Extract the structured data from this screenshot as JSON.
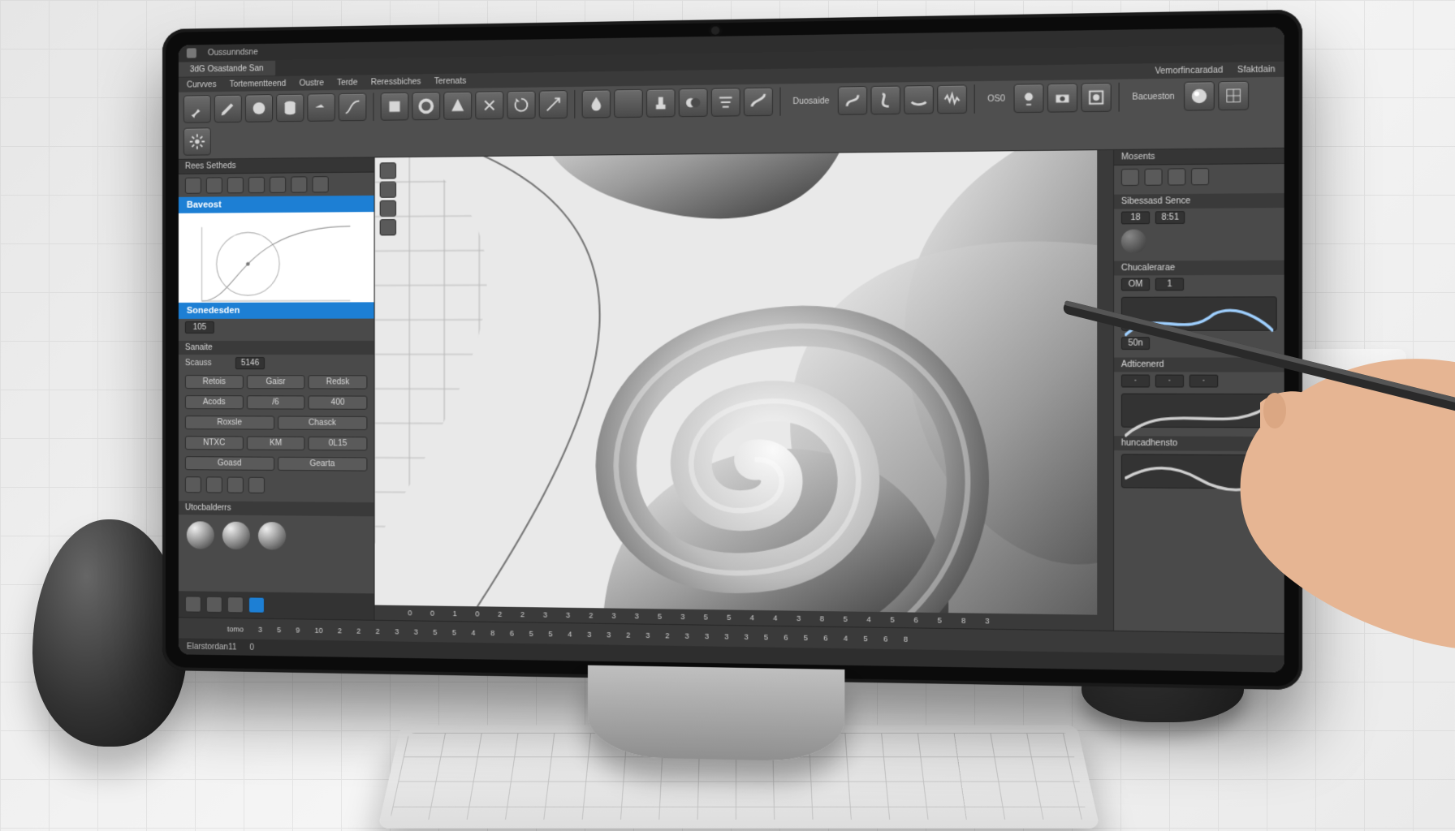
{
  "app": {
    "title": "Oussunndsne",
    "tab1": "3dG Osastande San"
  },
  "menu": {
    "items": [
      "Curvves",
      "Tortementteend",
      "Oustre",
      "Terde",
      "Reressbiches",
      "Terenats",
      "Vemorfincaradad",
      "Sfaktdain"
    ],
    "ribbon_groups": [
      "Duosaide",
      "OS0",
      "Bacueston"
    ]
  },
  "left_panel": {
    "title": "Rees Setheds",
    "section_blue_1": "Baveost",
    "section_blue_2": "Sonedesden",
    "val_105": "105",
    "sub_sneaite": "Sanaite",
    "row1": {
      "label": "Scauss",
      "value": "5146"
    },
    "row2": {
      "a": "Retois",
      "b": "Gaisr",
      "c": "Redsk"
    },
    "row3": {
      "a": "Acods",
      "b": "/6",
      "c": "400"
    },
    "row4": {
      "a": "Roxsle",
      "b": "Chasck"
    },
    "row5": {
      "a": "NTXC",
      "b": "KM",
      "c": "0L15"
    },
    "row6": {
      "a": "Goasd",
      "b": "Gearta"
    },
    "footer": "Utocbalderrs"
  },
  "right_panel": {
    "title": "Mosents",
    "section": "Sibessasd Sence",
    "row1": {
      "a": "18",
      "b": "8:51"
    },
    "sub": "Chucalerarae",
    "row2": {
      "a": "OM",
      "b": "1"
    },
    "gauge": "50n",
    "adv": "Adticenerd",
    "hist": "huncadhensto"
  },
  "timeline": {
    "label": "tomo",
    "ticks": [
      "3",
      "5",
      "9",
      "10",
      "2",
      "2",
      "2",
      "3",
      "3",
      "5",
      "5",
      "4",
      "8",
      "6",
      "5",
      "5",
      "4",
      "3",
      "3",
      "2",
      "3",
      "2",
      "3",
      "3",
      "3",
      "3",
      "5",
      "6",
      "5",
      "6",
      "4",
      "5",
      "6",
      "8"
    ]
  },
  "frame_ruler": [
    "0",
    "0",
    "1",
    "0",
    "2",
    "2",
    "3",
    "3",
    "2",
    "3",
    "3",
    "5",
    "3",
    "5",
    "5",
    "4",
    "4",
    "3",
    "8",
    "5",
    "4",
    "5",
    "6",
    "5",
    "8",
    "3"
  ],
  "status": {
    "left": "Elarstordan11",
    "mid": "0"
  },
  "colors": {
    "accent": "#1d7fd4",
    "panel": "#4a4a4a",
    "dark": "#2e2e2e"
  }
}
